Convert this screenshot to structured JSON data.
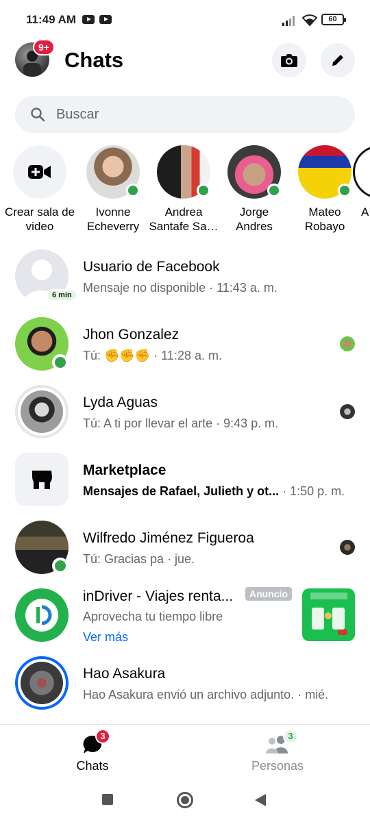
{
  "status_bar": {
    "time": "11:49 AM",
    "battery": "60"
  },
  "header": {
    "title": "Chats",
    "profile_badge": "9+"
  },
  "search": {
    "placeholder": "Buscar"
  },
  "stories": [
    {
      "label": "Crear sala de video"
    },
    {
      "label": "Ivonne Echeverry",
      "line1": "Ivonne",
      "line2": "Echeverry"
    },
    {
      "label": "Andrea Santafe Sa…",
      "line1": "Andrea",
      "line2": "Santafe Sa…"
    },
    {
      "label": "Jorge Andres",
      "line1": "Jorge",
      "line2": "Andres"
    },
    {
      "label": "Mateo Robayo",
      "line1": "Mateo",
      "line2": "Robayo"
    },
    {
      "label": "A",
      "line1": "A"
    }
  ],
  "create_room": {
    "line1": "Crear sala de",
    "line2": "video"
  },
  "chats": [
    {
      "name": "Usuario de Facebook",
      "message": "Mensaje no disponible · 11:43 a. m.",
      "badge": "6 min"
    },
    {
      "name": "Jhon Gonzalez",
      "message_prefix": "Tú: ",
      "emojis": "✊✊✊",
      "message_suffix": " · 11:28 a. m."
    },
    {
      "name": "Lyda Aguas",
      "message": "Tú: A ti por llevar el arte · 9:43 p. m."
    },
    {
      "name": "Marketplace",
      "message": "Mensajes de Rafael, Julieth y ot...",
      "time": " · 1:50 p. m."
    },
    {
      "name": "Wilfredo Jiménez Figueroa",
      "message": "Tú: Gracias pa · jue."
    },
    {
      "name": "inDriver - Viajes renta...",
      "message": "Aprovecha tu tiempo libre",
      "ad_tag": "Anuncio",
      "see_more": "Ver más"
    },
    {
      "name": "Hao Asakura",
      "message": "Hao Asakura envió un archivo adjunto. · mié."
    }
  ],
  "bottom_nav": {
    "chats": {
      "label": "Chats",
      "badge": "3"
    },
    "people": {
      "label": "Personas",
      "badge": "3"
    }
  },
  "colors": {
    "accent": "#0866ff",
    "online": "#31a24c",
    "badge": "#e41e3f"
  }
}
